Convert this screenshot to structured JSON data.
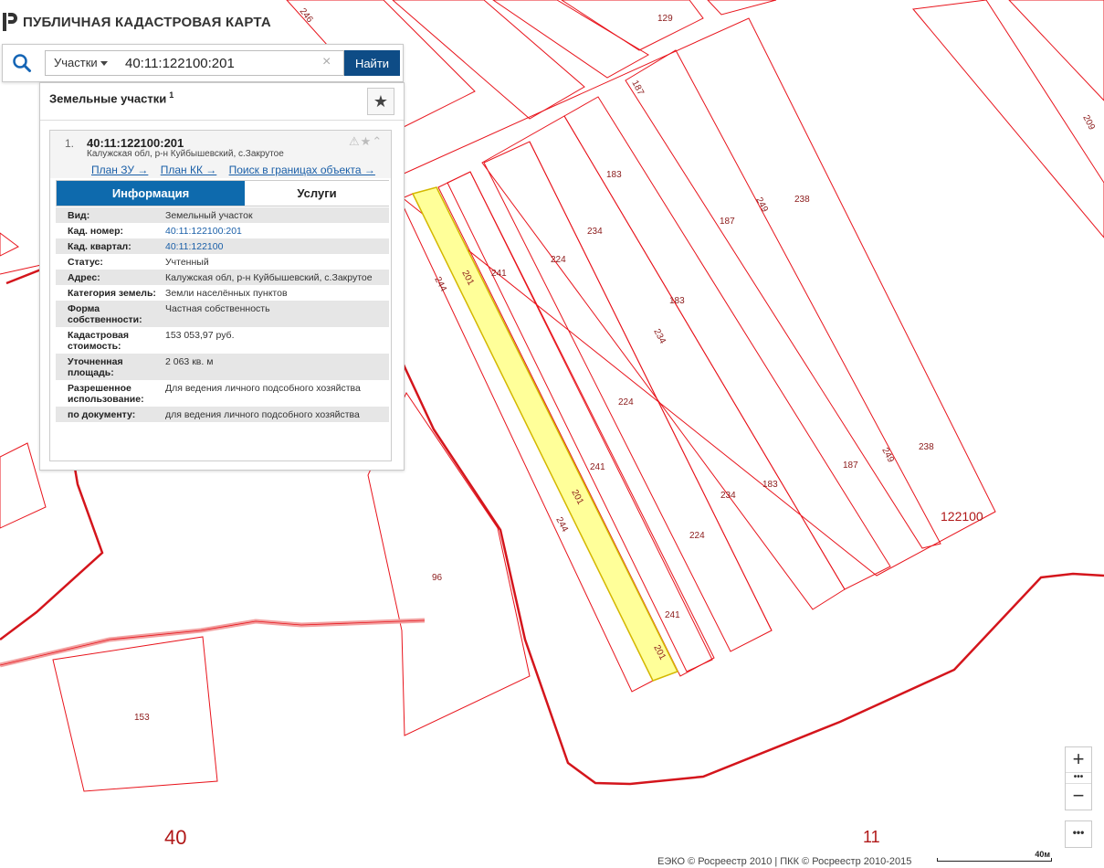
{
  "app": {
    "title": "ПУБЛИЧНАЯ КАДАСТРОВАЯ КАРТА"
  },
  "search": {
    "type_selected": "Участки",
    "query": "40:11:122100:201",
    "find_label": "Найти"
  },
  "results": {
    "title": "Земельные участки",
    "count": "1",
    "item": {
      "num": "1.",
      "cad_number": "40:11:122100:201",
      "address": "Калужская обл, р-н Куйбышевский, с.Закрутое",
      "links": [
        "План ЗУ →",
        "План КК →",
        "Поиск в границах объекта →"
      ]
    },
    "tabs": [
      "Информация",
      "Услуги"
    ],
    "info": [
      {
        "key": "Вид:",
        "value": "Земельный участок"
      },
      {
        "key": "Кад. номер:",
        "value": "40:11:122100:201"
      },
      {
        "key": "Кад. квартал:",
        "value": "40:11:122100"
      },
      {
        "key": "Статус:",
        "value": "Учтенный"
      },
      {
        "key": "Адрес:",
        "value": "Калужская обл, р-н Куйбышевский, с.Закрутое"
      },
      {
        "key": "Категория земель:",
        "value": "Земли населённых пунктов"
      },
      {
        "key": "Форма собственности:",
        "value": "Частная собственность"
      },
      {
        "key": "Кадастровая стоимость:",
        "value": "153 053,97 руб."
      },
      {
        "key": "Уточненная площадь:",
        "value": "2 063 кв. м"
      },
      {
        "key": "Разрешенное использование:",
        "value": "Для ведения личного подсобного хозяйства"
      },
      {
        "key": "по документу:",
        "value": "для ведения личного подсобного хозяйства"
      }
    ]
  },
  "map": {
    "parcel_labels": [
      "246",
      "129",
      "187",
      "209",
      "183",
      "238",
      "249",
      "234",
      "224",
      "241",
      "201",
      "244",
      "96",
      "153"
    ],
    "quarter_label": "122100",
    "district_labels": [
      "40",
      "11"
    ],
    "line_color": "#e8141c",
    "highlight_color": "#ffff99"
  },
  "controls": {
    "zoom_in": "+",
    "zoom_out": "−",
    "dots": "•••",
    "more": "•••"
  },
  "footer": {
    "attribution": "ЕЭКО © Росреестр 2010 | ПКК © Росреестр 2010-2015",
    "scale_label": "40м"
  }
}
